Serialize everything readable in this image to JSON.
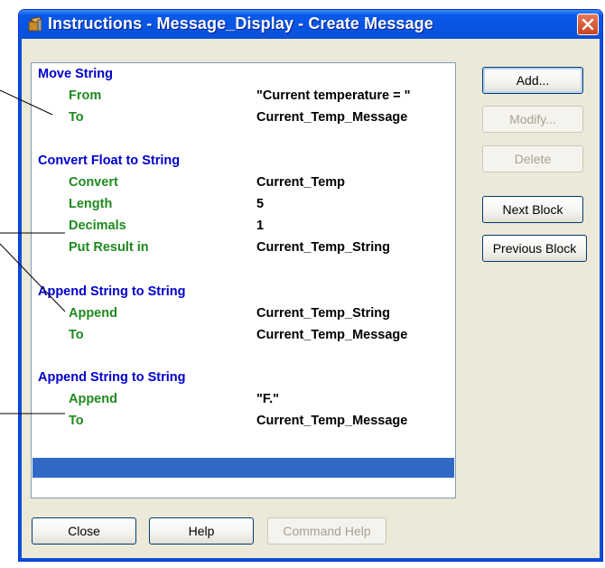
{
  "window": {
    "title": "Instructions - Message_Display - Create Message",
    "title_icon": "tool-icon",
    "close_icon": "close-icon"
  },
  "instruction_list": [
    {
      "title": "Move String",
      "params": [
        {
          "name": "From",
          "value": "\"Current temperature = \""
        },
        {
          "name": "To",
          "value": "Current_Temp_Message"
        }
      ]
    },
    {
      "title": "Convert Float to String",
      "params": [
        {
          "name": "Convert",
          "value": "Current_Temp"
        },
        {
          "name": "Length",
          "value": "5"
        },
        {
          "name": "Decimals",
          "value": "1"
        },
        {
          "name": "Put Result in",
          "value": "Current_Temp_String"
        }
      ]
    },
    {
      "title": "Append String to String",
      "params": [
        {
          "name": "Append",
          "value": "Current_Temp_String"
        },
        {
          "name": "To",
          "value": "Current_Temp_Message"
        }
      ]
    },
    {
      "title": "Append String to String",
      "params": [
        {
          "name": "Append",
          "value": "\"F.\""
        },
        {
          "name": "To",
          "value": "Current_Temp_Message"
        }
      ]
    }
  ],
  "side_buttons": {
    "add": "Add...",
    "modify": "Modify...",
    "delete": "Delete",
    "next_block": "Next Block",
    "previous_block": "Previous Block"
  },
  "bottom_buttons": {
    "close": "Close",
    "help": "Help",
    "command_help": "Command Help"
  },
  "colors": {
    "title_bar": "#0a59e8",
    "block_title": "#0000cc",
    "param_name": "#1f8a1f",
    "selection": "#3169c6"
  }
}
